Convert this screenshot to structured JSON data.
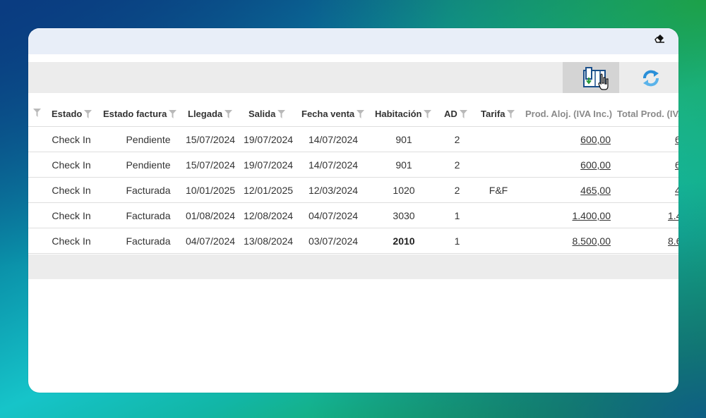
{
  "topbar": {
    "eraser_icon": "eraser-icon"
  },
  "toolbar": {
    "export_icon": "export-excel-icon",
    "refresh_icon": "refresh-icon"
  },
  "grid": {
    "columns": [
      "Estado",
      "Estado factura",
      "Llegada",
      "Salida",
      "Fecha venta",
      "Habitación",
      "AD",
      "Tarifa",
      "Prod. Aloj. (IVA Inc.)",
      "Total Prod. (IVA"
    ],
    "rows": [
      {
        "estado": "Check In",
        "estado_factura": "Pendiente",
        "llegada": "15/07/2024",
        "salida": "19/07/2024",
        "fecha_venta": "14/07/2024",
        "habitacion": "901",
        "ad": "2",
        "tarifa": "",
        "prod_aloj": "600,00",
        "total_prod": "6"
      },
      {
        "estado": "Check In",
        "estado_factura": "Pendiente",
        "llegada": "15/07/2024",
        "salida": "19/07/2024",
        "fecha_venta": "14/07/2024",
        "habitacion": "901",
        "ad": "2",
        "tarifa": "",
        "prod_aloj": "600,00",
        "total_prod": "6"
      },
      {
        "estado": "Check In",
        "estado_factura": "Facturada",
        "llegada": "10/01/2025",
        "salida": "12/01/2025",
        "fecha_venta": "12/03/2024",
        "habitacion": "1020",
        "ad": "2",
        "tarifa": "F&F",
        "prod_aloj": "465,00",
        "total_prod": "4"
      },
      {
        "estado": "Check In",
        "estado_factura": "Facturada",
        "llegada": "01/08/2024",
        "salida": "12/08/2024",
        "fecha_venta": "04/07/2024",
        "habitacion": "3030",
        "ad": "1",
        "tarifa": "",
        "prod_aloj": "1.400,00",
        "total_prod": "1.4"
      },
      {
        "estado": "Check In",
        "estado_factura": "Facturada",
        "llegada": "04/07/2024",
        "salida": "13/08/2024",
        "fecha_venta": "03/07/2024",
        "habitacion": "2010",
        "ad": "1",
        "tarifa": "",
        "prod_aloj": "8.500,00",
        "total_prod": "8.6"
      }
    ]
  }
}
